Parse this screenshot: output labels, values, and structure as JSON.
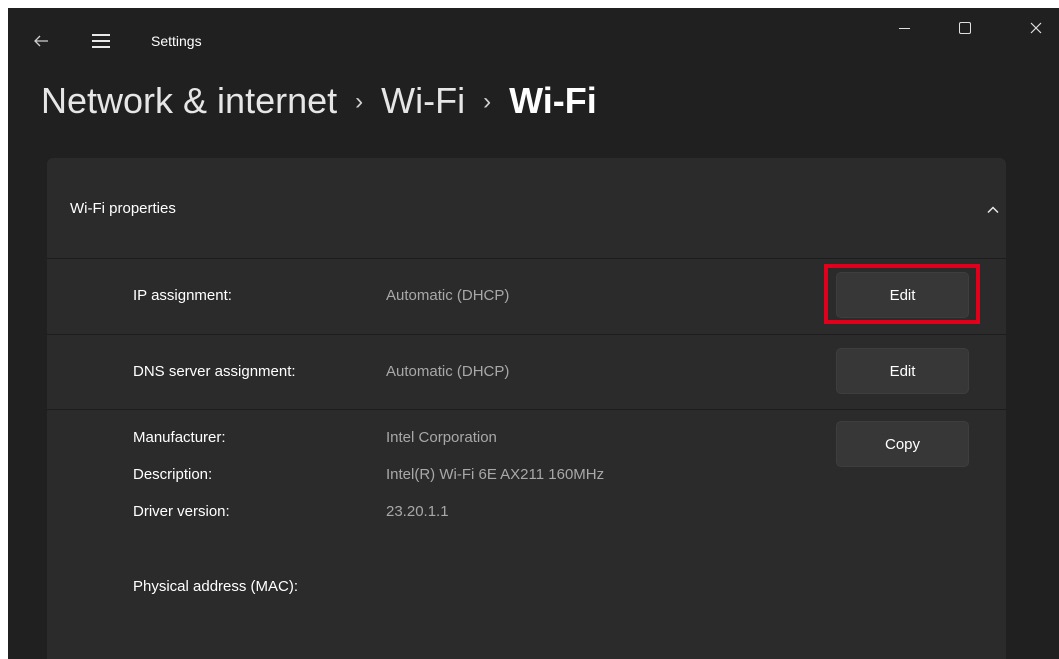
{
  "window": {
    "title": "Settings",
    "controls": {
      "minimize": "minimize-icon",
      "maximize": "maximize-icon",
      "close": "close-icon"
    }
  },
  "breadcrumb": {
    "items": [
      "Network & internet",
      "Wi-Fi",
      "Wi-Fi"
    ],
    "separator": "›"
  },
  "card": {
    "title": "Wi-Fi properties",
    "expanded": true,
    "rows": {
      "ip": {
        "label": "IP assignment:",
        "value": "Automatic (DHCP)",
        "button": "Edit"
      },
      "dns": {
        "label": "DNS server assignment:",
        "value": "Automatic (DHCP)",
        "button": "Edit"
      },
      "hardware": {
        "manufacturer_label": "Manufacturer:",
        "manufacturer_value": "Intel Corporation",
        "description_label": "Description:",
        "description_value": "Intel(R) Wi-Fi 6E AX211 160MHz",
        "driver_label": "Driver version:",
        "driver_value": "23.20.1.1",
        "mac_label": "Physical address (MAC):",
        "mac_value": "",
        "button": "Copy"
      }
    }
  },
  "colors": {
    "background": "#202020",
    "card": "#2b2b2b",
    "button": "#373737",
    "highlight": "#e0001b",
    "secondary_text": "#a8a8a8"
  }
}
